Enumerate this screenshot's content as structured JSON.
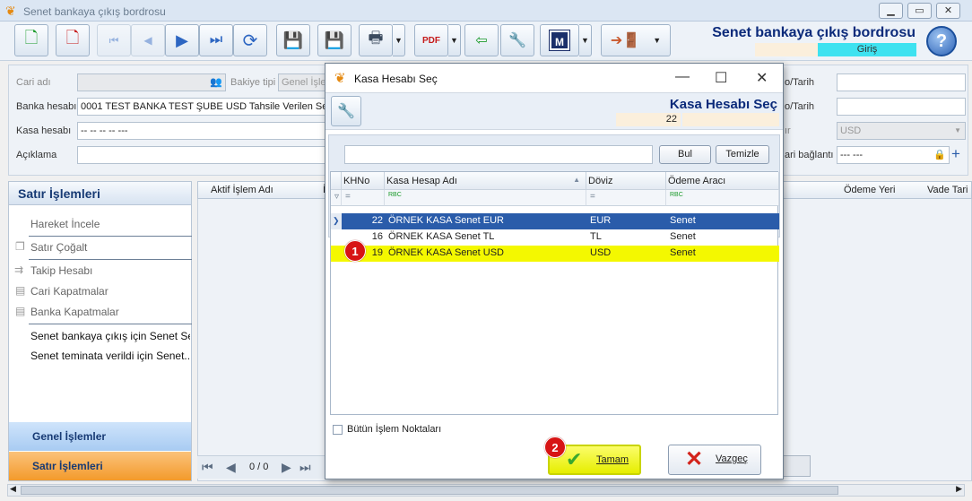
{
  "window": {
    "title": "Senet bankaya çıkış bordrosu"
  },
  "header": {
    "form_title": "Senet bankaya çıkış bordrosu",
    "mode": "Giriş"
  },
  "form": {
    "cari_label": "Cari adı",
    "bakiye_label": "Bakiye tipi",
    "bakiye_value": "Genel İşlem",
    "banka_label": "Banka hesabı",
    "banka_value": "0001 TEST BANKA TEST ŞUBE USD Tahsile Verilen Senetler",
    "kasa_label": "Kasa hesabı",
    "kasa_value": "-- -- -- -- ---",
    "aciklama_label": "Açıklama",
    "tarih_label1": "o/Tarih",
    "tarih_label2": "o/Tarih",
    "doviz_label": "ır",
    "doviz_value": "USD",
    "bag_label": "ari bağlantı",
    "bag_value": "--- ---"
  },
  "sidebar": {
    "title": "Satır İşlemleri",
    "items": [
      "Hareket İncele",
      "Satır Çoğalt",
      "Takip Hesabı",
      "Cari Kapatmalar",
      "Banka Kapatmalar",
      "Senet bankaya çıkış için Senet Seç",
      "Senet teminata verildi için Senet..."
    ],
    "nav_general": "Genel İşlemler",
    "nav_rows": "Satır İşlemleri"
  },
  "grid": {
    "columns": [
      "Aktif İşlem Adı",
      "İ",
      "Ödeme Yeri",
      "Vade Tari"
    ],
    "pager": "0 / 0"
  },
  "dialog": {
    "title": "Kasa Hesabı Seç",
    "heading": "Kasa Hesabı Seç",
    "count": "22",
    "find_btn": "Bul",
    "clear_btn": "Temizle",
    "columns": [
      "KHNo",
      "Kasa Hesap Adı",
      "Döviz",
      "Ödeme Aracı"
    ],
    "filters": [
      "=",
      "RBC",
      "=",
      "RBC"
    ],
    "rows": [
      {
        "no": "22",
        "name": "ÖRNEK KASA Senet EUR",
        "cur": "EUR",
        "tool": "Senet"
      },
      {
        "no": "16",
        "name": "ÖRNEK KASA Senet TL",
        "cur": "TL",
        "tool": "Senet"
      },
      {
        "no": "19",
        "name": "ÖRNEK KASA Senet USD",
        "cur": "USD",
        "tool": "Senet"
      }
    ],
    "all_points_label": "Bütün İşlem Noktaları",
    "ok_btn": "Tamam",
    "cancel_btn": "Vazgeç"
  },
  "annotations": {
    "one": "1",
    "two": "2"
  }
}
